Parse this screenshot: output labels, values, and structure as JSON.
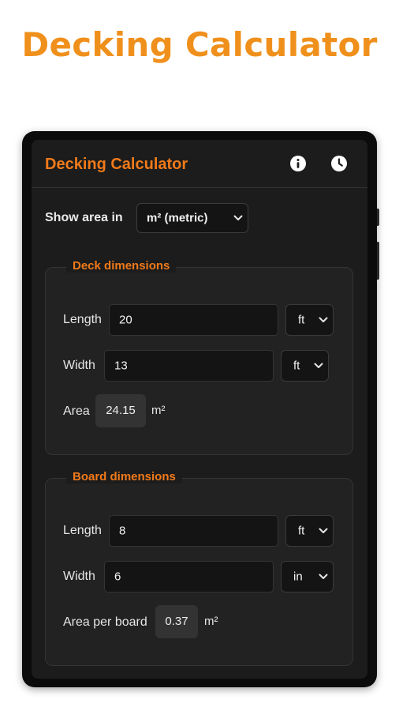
{
  "promo": {
    "headline": "Decking Calculator",
    "accent_color": "#f0901c"
  },
  "app": {
    "title": "Decking Calculator",
    "title_color": "#f07a1a",
    "icons": {
      "info": "info-icon",
      "history": "clock-icon"
    }
  },
  "area_unit": {
    "label": "Show area in",
    "selected": "m² (metric)"
  },
  "deck": {
    "legend": "Deck dimensions",
    "length": {
      "label": "Length",
      "value": "20",
      "unit": "ft"
    },
    "width": {
      "label": "Width",
      "value": "13",
      "unit": "ft"
    },
    "area": {
      "label": "Area",
      "value": "24.15",
      "unit": "m²"
    }
  },
  "board": {
    "legend": "Board dimensions",
    "length": {
      "label": "Length",
      "value": "8",
      "unit": "ft"
    },
    "width": {
      "label": "Width",
      "value": "6",
      "unit": "in"
    },
    "area": {
      "label": "Area per board",
      "value": "0.37",
      "unit": "m²"
    }
  }
}
